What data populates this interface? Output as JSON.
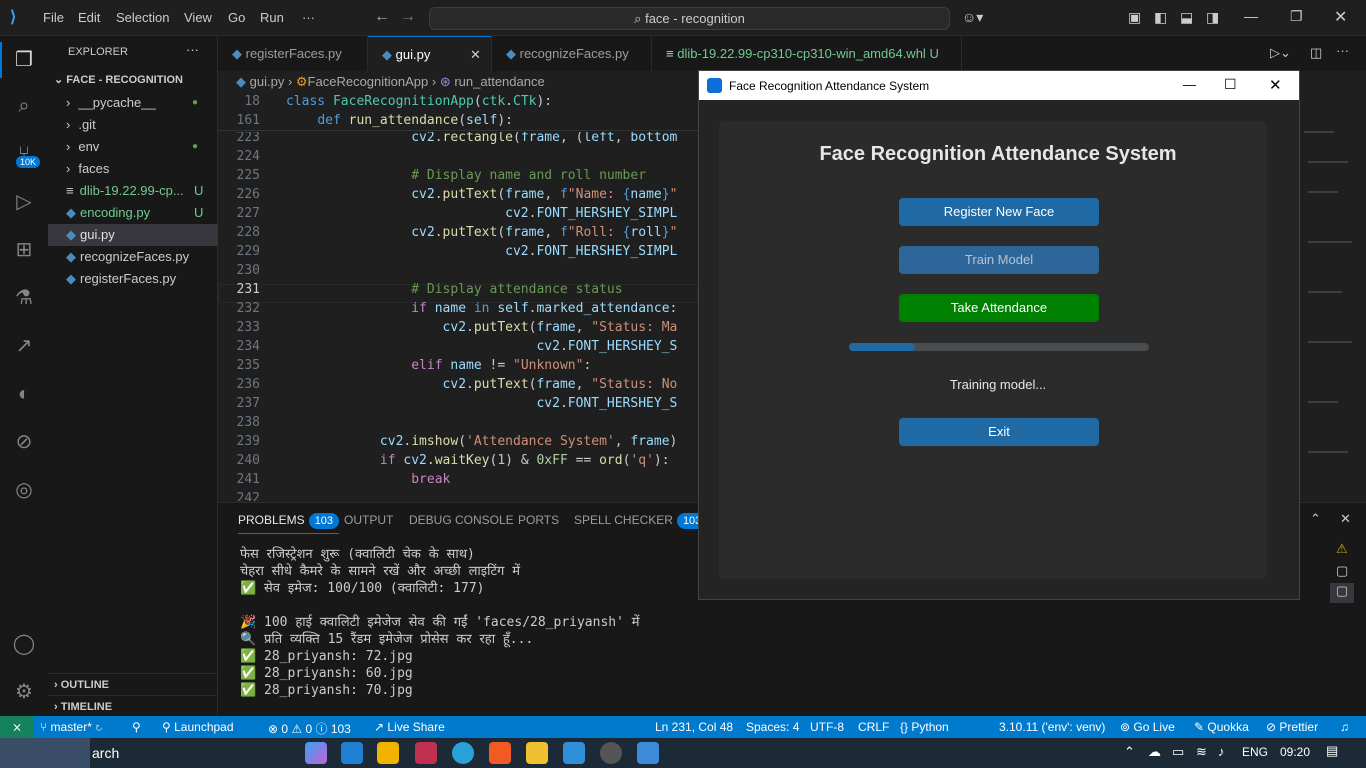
{
  "menu": [
    "File",
    "Edit",
    "Selection",
    "View",
    "Go",
    "Run",
    "···"
  ],
  "search": "face - recognition",
  "explorer": {
    "title": "EXPLORER",
    "folder": "FACE - RECOGNITION",
    "items": [
      {
        "label": "__pycache__",
        "marker": "●",
        "kind": "folder"
      },
      {
        "label": ".git",
        "marker": "",
        "kind": "folder"
      },
      {
        "label": "env",
        "marker": "●",
        "kind": "folder"
      },
      {
        "label": "faces",
        "marker": "",
        "kind": "folder"
      },
      {
        "label": "dlib-19.22.99-cp...",
        "marker": "U",
        "kind": "file"
      },
      {
        "label": "encoding.py",
        "marker": "U",
        "kind": "py"
      },
      {
        "label": "gui.py",
        "marker": "",
        "kind": "py"
      },
      {
        "label": "recognizeFaces.py",
        "marker": "",
        "kind": "py"
      },
      {
        "label": "registerFaces.py",
        "marker": "",
        "kind": "py"
      }
    ],
    "outline": "OUTLINE",
    "timeline": "TIMELINE"
  },
  "tabs": [
    "registerFaces.py",
    "gui.py",
    "recognizeFaces.py",
    "dlib-19.22.99-cp310-cp310-win_amd64.whl"
  ],
  "tab_u": "U",
  "breadcrumb": [
    "gui.py",
    "FaceRecognitionApp",
    "run_attendance"
  ],
  "sticky": [
    {
      "n": "18",
      "t": "class FaceRecognitionApp(ctk.CTk):"
    },
    {
      "n": "161",
      "t": "    def run_attendance(self):"
    }
  ],
  "code": [
    {
      "n": "223",
      "t": "                cv2.rectangle(frame, (left, bottom"
    },
    {
      "n": "224",
      "t": ""
    },
    {
      "n": "225",
      "t": "                # Display name and roll number"
    },
    {
      "n": "226",
      "t": "                cv2.putText(frame, f\"Name: {name}\""
    },
    {
      "n": "227",
      "t": "                            cv2.FONT_HERSHEY_SIMPL"
    },
    {
      "n": "228",
      "t": "                cv2.putText(frame, f\"Roll: {roll}\""
    },
    {
      "n": "229",
      "t": "                            cv2.FONT_HERSHEY_SIMPL"
    },
    {
      "n": "230",
      "t": ""
    },
    {
      "n": "231",
      "t": "                # Display attendance status"
    },
    {
      "n": "232",
      "t": "                if name in self.marked_attendance:"
    },
    {
      "n": "233",
      "t": "                    cv2.putText(frame, \"Status: Ma"
    },
    {
      "n": "234",
      "t": "                                cv2.FONT_HERSHEY_S"
    },
    {
      "n": "235",
      "t": "                elif name != \"Unknown\":"
    },
    {
      "n": "236",
      "t": "                    cv2.putText(frame, \"Status: No"
    },
    {
      "n": "237",
      "t": "                                cv2.FONT_HERSHEY_S"
    },
    {
      "n": "238",
      "t": ""
    },
    {
      "n": "239",
      "t": "            cv2.imshow('Attendance System', frame)"
    },
    {
      "n": "240",
      "t": "            if cv2.waitKey(1) & 0xFF == ord('q'):"
    },
    {
      "n": "241",
      "t": "                break"
    },
    {
      "n": "242",
      "t": ""
    }
  ],
  "panel": {
    "tabs": [
      "PROBLEMS",
      "OUTPUT",
      "DEBUG CONSOLE",
      "PORTS",
      "SPELL CHECKER"
    ],
    "problems": "103",
    "spell": "103",
    "lines": [
      "फेस रजिस्ट्रेशन शुरू (क्वालिटी चेक के साथ)",
      "चेहरा सीधे कैमरे के सामने रखें और अच्छी लाइटिंग में",
      "✅ सेव इमेज: 100/100 (क्वालिटी: 177)",
      "",
      "🎉 100 हाई क्वालिटी इमेजेज सेव की गईं 'faces/28_priyansh' में",
      "🔍 प्रति व्यक्ति 15 रैंडम इमेजेज प्रोसेस कर रहा हूँ...",
      "✅ 28_priyansh: 72.jpg",
      "✅ 28_priyansh: 60.jpg",
      "✅ 28_priyansh: 70.jpg"
    ]
  },
  "status": {
    "branch": "master*",
    "launchpad": "Launchpad",
    "problems": "⊗ 0 ⚠ 0 ⓘ 103",
    "liveshare": "Live Share",
    "pos": "Ln 231, Col 48",
    "spaces": "Spaces: 4",
    "enc": "UTF-8",
    "eol": "CRLF",
    "lang": "{} Python",
    "py": "3.10.11 ('env': venv)",
    "golive": "Go Live",
    "quokka": "Quokka",
    "prettier": "Prettier"
  },
  "taskbar": {
    "search": "arch",
    "lang": "ENG",
    "time": "09:20"
  },
  "app": {
    "window_title": "Face Recognition Attendance System",
    "heading": "Face Recognition Attendance System",
    "register": "Register New Face",
    "train": "Train Model",
    "take": "Take Attendance",
    "status": "Training model...",
    "exit": "Exit",
    "progress": 0.22,
    "colors": {
      "blue": "#1f6aa5",
      "blue_disabled": "#3a6a94",
      "green": "#008000"
    }
  }
}
